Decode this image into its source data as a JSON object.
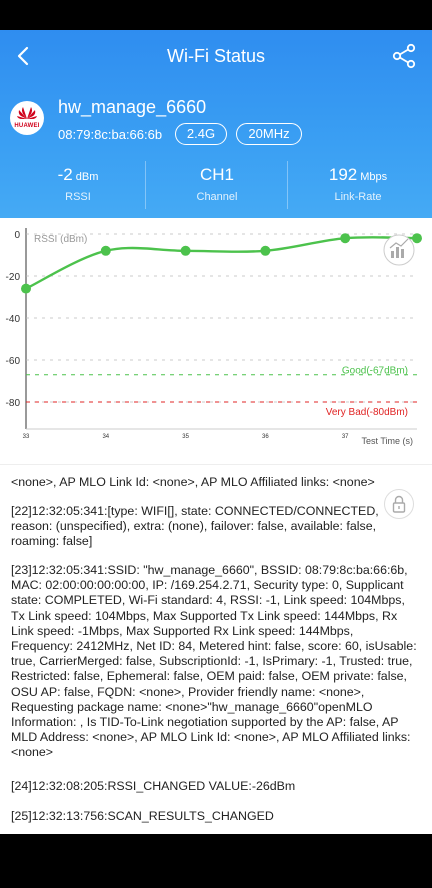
{
  "header": {
    "title": "Wi-Fi Status",
    "ssid": "hw_manage_6660",
    "bssid": "08:79:8c:ba:66:6b",
    "band": "2.4G",
    "channel_width": "20MHz",
    "logo_text": "HUAWEI"
  },
  "stats": {
    "rssi": {
      "value": "-2",
      "unit": "dBm",
      "label": "RSSI"
    },
    "channel": {
      "value": "CH1",
      "label": "Channel"
    },
    "link_rate": {
      "value": "192",
      "unit": "Mbps",
      "label": "Link-Rate"
    }
  },
  "chart": {
    "y_label": "RSSI (dBm)",
    "x_label": "Test Time (s)",
    "good_label": "Good(-67dBm)",
    "very_bad_label": "Very Bad(-80dBm)",
    "colors": {
      "line": "#4cc24c",
      "good": "#4cc24c",
      "very_bad": "#e02424"
    }
  },
  "chart_data": {
    "type": "line",
    "ylabel": "RSSI (dBm)",
    "xlabel": "Test Time (s)",
    "ylim": [
      -90,
      0
    ],
    "y_ticks": [
      "0",
      "-20",
      "-40",
      "-60",
      "-80"
    ],
    "x_ticks": [
      "33",
      "34",
      "35",
      "36",
      "37"
    ],
    "x": [
      33,
      34,
      35,
      36,
      37,
      37.9
    ],
    "values": [
      -26,
      -8,
      -8,
      -8,
      -2,
      -2
    ],
    "thresholds": [
      {
        "label": "Good(-67dBm)",
        "value": -67
      },
      {
        "label": "Very Bad(-80dBm)",
        "value": -80
      }
    ]
  },
  "log": {
    "entries": [
      "<none>, AP MLO Link Id: <none>, AP MLO Affiliated links: <none>",
      "[22]12:32:05:341:[type: WIFI[], state: CONNECTED/CONNECTED, reason: (unspecified), extra: (none), failover: false, available: false, roaming: false]",
      "[23]12:32:05:341:SSID: \"hw_manage_6660\", BSSID: 08:79:8c:ba:66:6b, MAC: 02:00:00:00:00:00, IP: /169.254.2.71, Security type: 0, Supplicant state: COMPLETED, Wi-Fi standard: 4, RSSI: -1, Link speed: 104Mbps, Tx Link speed: 104Mbps, Max Supported Tx Link speed: 144Mbps, Rx Link speed: -1Mbps, Max Supported Rx Link speed: 144Mbps, Frequency: 2412MHz, Net ID: 84, Metered hint: false, score: 60, isUsable: true, CarrierMerged: false, SubscriptionId: -1, IsPrimary: -1, Trusted: true, Restricted: false, Ephemeral: false, OEM paid: false, OEM private: false, OSU AP: false, FQDN: <none>, Provider friendly name: <none>, Requesting package name: <none>\"hw_manage_6660\"openMLO Information: , Is TID-To-Link negotiation supported by the AP: false, AP MLD Address: <none>, AP MLO Link Id: <none>, AP MLO Affiliated links: <none>",
      "[24]12:32:08:205:RSSI_CHANGED  VALUE:-26dBm",
      "[25]12:32:13:756:SCAN_RESULTS_CHANGED"
    ]
  }
}
